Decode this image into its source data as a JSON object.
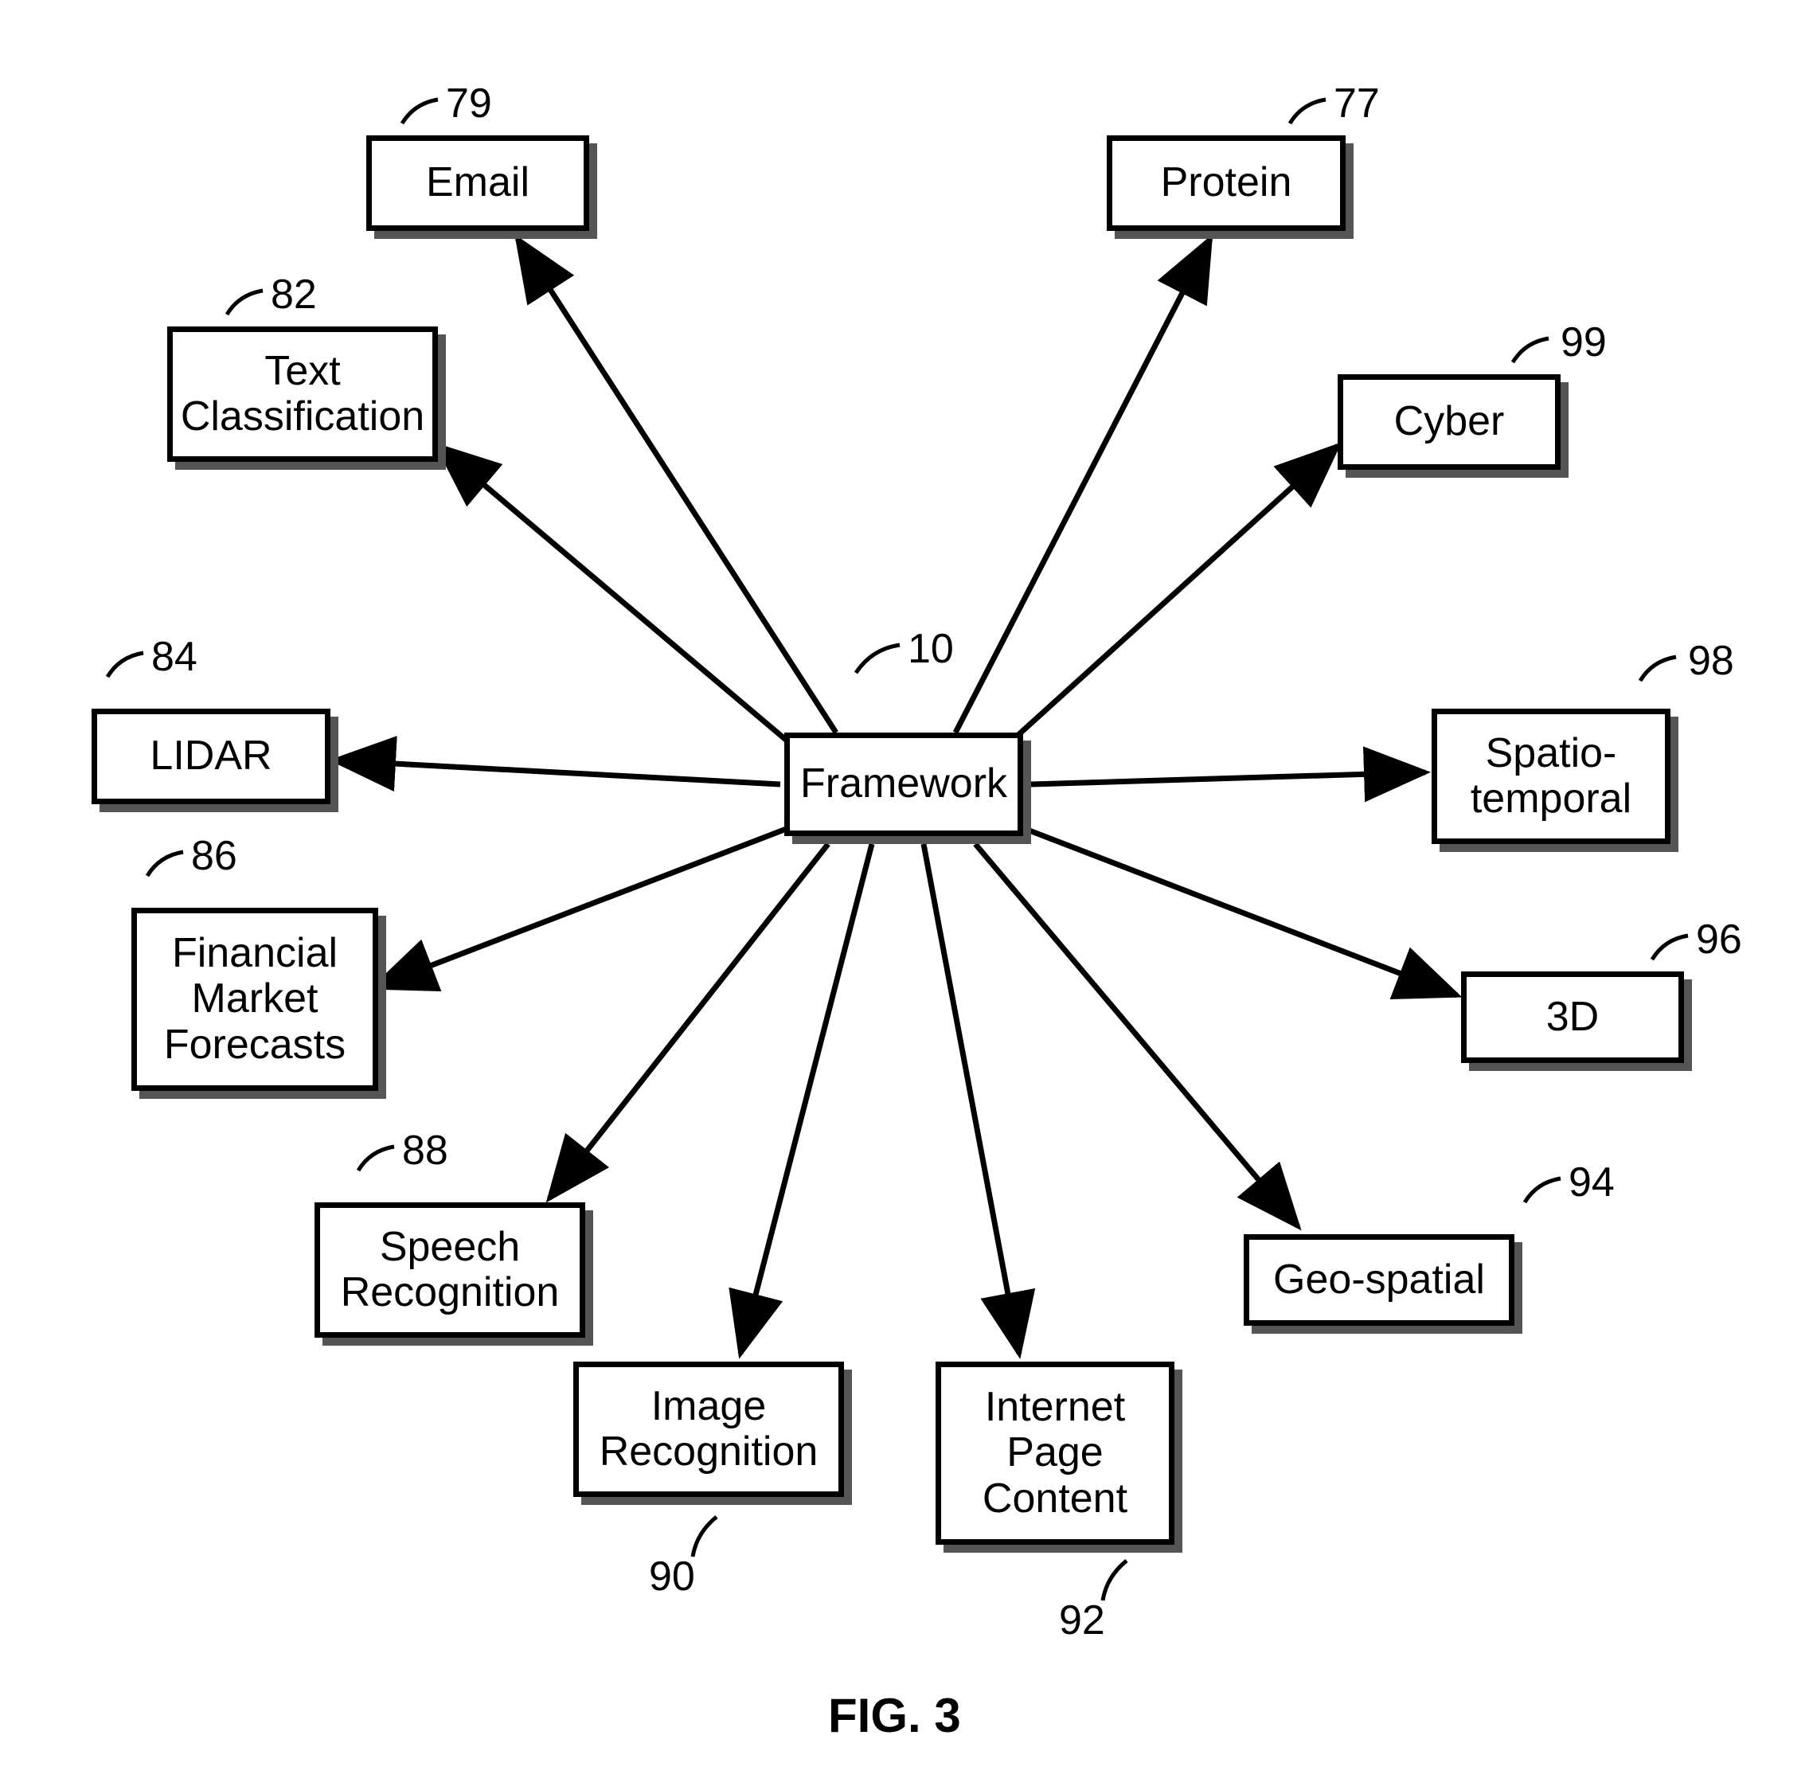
{
  "caption": "FIG. 3",
  "center": {
    "ref": "10",
    "label": "Framework"
  },
  "nodes": {
    "n79": {
      "ref": "79",
      "label": "Email"
    },
    "n77": {
      "ref": "77",
      "label": "Protein"
    },
    "n82": {
      "ref": "82",
      "label": "Text\nClassification"
    },
    "n99": {
      "ref": "99",
      "label": "Cyber"
    },
    "n84": {
      "ref": "84",
      "label": "LIDAR"
    },
    "n98": {
      "ref": "98",
      "label": "Spatio-\ntemporal"
    },
    "n86": {
      "ref": "86",
      "label": "Financial\nMarket\nForecasts"
    },
    "n96": {
      "ref": "96",
      "label": "3D"
    },
    "n88": {
      "ref": "88",
      "label": "Speech\nRecognition"
    },
    "n94": {
      "ref": "94",
      "label": "Geo-spatial"
    },
    "n90": {
      "ref": "90",
      "label": "Image\nRecognition"
    },
    "n92": {
      "ref": "92",
      "label": "Internet\nPage\nContent"
    }
  }
}
